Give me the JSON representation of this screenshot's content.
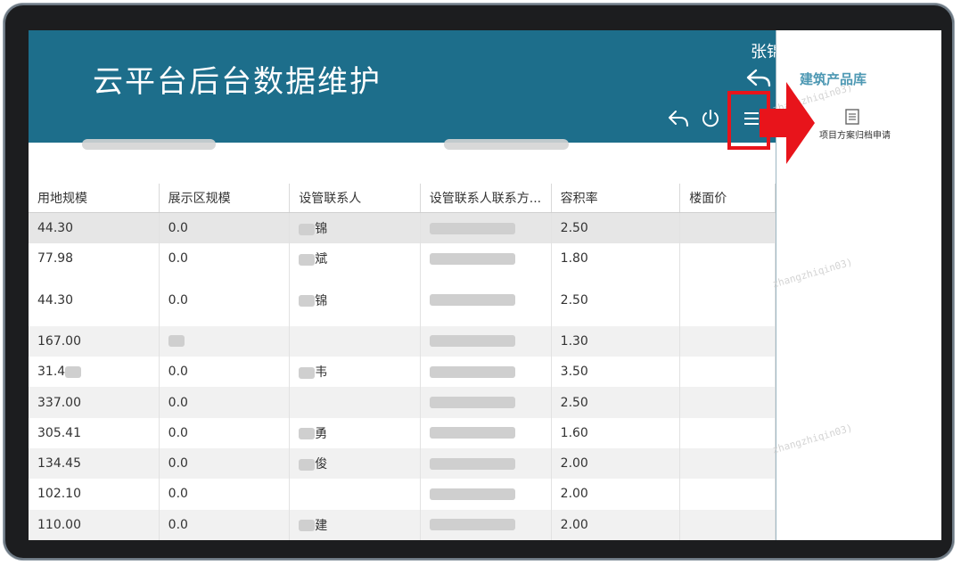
{
  "header": {
    "app_title": "云平台后台数据维护",
    "user_name": "张锦"
  },
  "side_panel": {
    "title": "建筑产品库",
    "item_label": "项目方案归档申请"
  },
  "watermark_text": "zhangzhiqin03)",
  "table": {
    "columns": [
      "用地规模",
      "展示区规模",
      "设管联系人",
      "设管联系人联系方...",
      "容积率",
      "楼面价"
    ],
    "rows": [
      {
        "land": "44.30",
        "display": "0.0",
        "contact": "锦",
        "phone": "",
        "far": "2.50",
        "price": ""
      },
      {
        "land": "77.98",
        "display": "0.0",
        "contact": "斌",
        "phone": "",
        "far": "1.80",
        "price": ""
      },
      {
        "land": "44.30",
        "display": "0.0",
        "contact": "锦",
        "phone": "",
        "far": "2.50",
        "price": ""
      },
      {
        "land": "167.00",
        "display": "",
        "contact": "",
        "phone": "",
        "far": "1.30",
        "price": ""
      },
      {
        "land": "31.4",
        "display": "0.0",
        "contact": "韦",
        "phone": "",
        "far": "3.50",
        "price": ""
      },
      {
        "land": "337.00",
        "display": "0.0",
        "contact": "",
        "phone": "",
        "far": "2.50",
        "price": ""
      },
      {
        "land": "305.41",
        "display": "0.0",
        "contact": "勇",
        "phone": "",
        "far": "1.60",
        "price": ""
      },
      {
        "land": "134.45",
        "display": "0.0",
        "contact": "俊",
        "phone": "",
        "far": "2.00",
        "price": ""
      },
      {
        "land": "102.10",
        "display": "0.0",
        "contact": "",
        "phone": "",
        "far": "2.00",
        "price": ""
      },
      {
        "land": "110.00",
        "display": "0.0",
        "contact": "建",
        "phone": "",
        "far": "2.00",
        "price": ""
      }
    ]
  },
  "colors": {
    "header_bg": "#1d6e8b",
    "highlight": "#e8141b",
    "side_title": "#4d98b3"
  },
  "icons": [
    "back-arrow-icon",
    "power-icon",
    "hamburger-menu-icon",
    "document-icon",
    "red-arrow-icon"
  ]
}
